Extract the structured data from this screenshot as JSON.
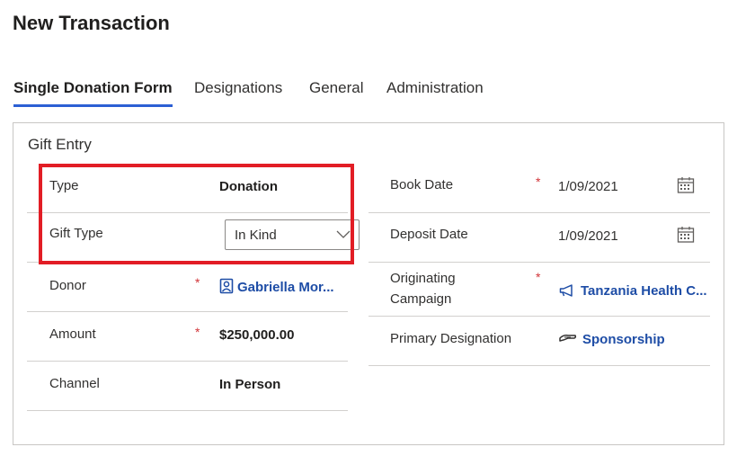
{
  "page": {
    "title": "New Transaction"
  },
  "tabs": [
    {
      "label": "Single Donation Form",
      "active": true
    },
    {
      "label": "Designations",
      "active": false
    },
    {
      "label": "General",
      "active": false
    },
    {
      "label": "Administration",
      "active": false
    }
  ],
  "section": {
    "title": "Gift Entry"
  },
  "left_fields": {
    "type": {
      "label": "Type",
      "value": "Donation"
    },
    "gift_type": {
      "label": "Gift Type",
      "value": "In Kind"
    },
    "donor": {
      "label": "Donor",
      "required_mark": "*",
      "value": "Gabriella Mor...",
      "icon": "contact-icon"
    },
    "amount": {
      "label": "Amount",
      "required_mark": "*",
      "value": "$250,000.00"
    },
    "channel": {
      "label": "Channel",
      "value": "In Person"
    }
  },
  "right_fields": {
    "book_date": {
      "label": "Book Date",
      "required_mark": "*",
      "value": "1/09/2021",
      "icon": "calendar-icon"
    },
    "deposit_date": {
      "label": "Deposit Date",
      "value": "1/09/2021",
      "icon": "calendar-icon"
    },
    "originating_campaign": {
      "label_line1": "Originating",
      "label_line2": "Campaign",
      "required_mark": "*",
      "value": "Tanzania Health C...",
      "icon": "megaphone-icon"
    },
    "primary_designation": {
      "label": "Primary Designation",
      "value": "Sponsorship",
      "icon": "designation-icon"
    }
  },
  "colors": {
    "accent": "#2c5fd4",
    "link": "#1e4da6",
    "required": "#d13438",
    "highlight": "#e21d25"
  }
}
